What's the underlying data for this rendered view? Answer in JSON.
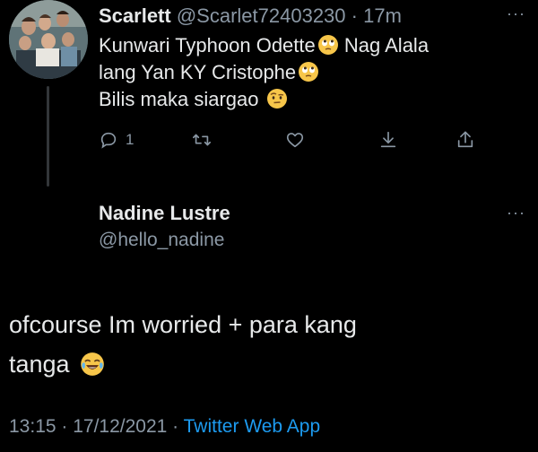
{
  "reply_tweet": {
    "display_name": "Scarlett",
    "handle": "@Scarlet72403230",
    "separator": "·",
    "time_ago": "17m",
    "more_label": "···",
    "lines": [
      {
        "text": "Kunwari  Typhoon Odette",
        "emoji": "face-with-rolling-eyes",
        "tail": " Nag Alala"
      },
      {
        "text": "lang Yan KY Cristophe",
        "emoji": "face-with-rolling-eyes",
        "tail": ""
      },
      {
        "text": "Bilis maka siargao ",
        "emoji": "face-with-raised-eyebrow",
        "tail": ""
      }
    ],
    "actions": {
      "reply_count": "1"
    },
    "icons": [
      "reply-icon",
      "retweet-icon",
      "like-icon",
      "bookmark-download-icon",
      "share-icon"
    ]
  },
  "main_tweet": {
    "display_name": "Nadine Lustre",
    "handle": "@hello_nadine",
    "more_label": "···",
    "text_line1": "ofcourse Im worried + para kang",
    "text_line2": "tanga ",
    "text_emoji": "face-with-tears-of-joy",
    "time": "13:15",
    "separator1": " · ",
    "date": "17/12/2021",
    "separator2": " · ",
    "source": "Twitter Web App"
  },
  "colors": {
    "background": "#000000",
    "text": "#e7e9ea",
    "secondary": "#8b98a5",
    "link": "#1d9bf0",
    "thread_line": "#333639"
  }
}
